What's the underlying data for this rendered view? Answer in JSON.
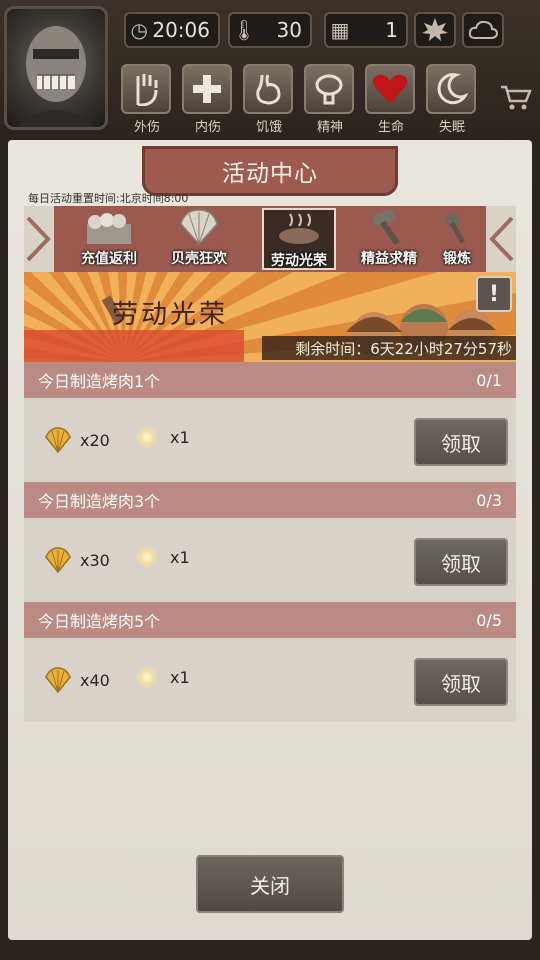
{
  "hud": {
    "time": "20:06",
    "temperature": "30",
    "day": "1",
    "status_icons": [
      {
        "icon": "palm-icon",
        "label": "外伤"
      },
      {
        "icon": "plus-icon",
        "label": "内伤"
      },
      {
        "icon": "stomach-icon",
        "label": "饥饿"
      },
      {
        "icon": "brain-icon",
        "label": "精神"
      },
      {
        "icon": "heart-icon",
        "label": "生命"
      },
      {
        "icon": "moon-icon",
        "label": "失眠"
      }
    ]
  },
  "panel": {
    "title": "活动中心",
    "reset_note": "每日活动重置时间:北京时间8:00",
    "tabs": [
      {
        "label": "充值返利",
        "icon": "chest-icon",
        "active": false
      },
      {
        "label": "贝壳狂欢",
        "icon": "shell-icon",
        "active": false
      },
      {
        "label": "劳动光荣",
        "icon": "meat-icon",
        "active": true
      },
      {
        "label": "精益求精",
        "icon": "hammer-icon",
        "active": false
      },
      {
        "label": "锻炼",
        "icon": "tool-icon",
        "active": false
      }
    ],
    "event": {
      "title": "劳动光荣",
      "remaining": "剩余时间：6天22小时27分57秒",
      "info_button": "!"
    },
    "tasks": [
      {
        "title": "今日制造烤肉1个",
        "progress": "0/1",
        "shell_amount": "x20",
        "orb_amount": "x1",
        "claim_label": "领取"
      },
      {
        "title": "今日制造烤肉3个",
        "progress": "0/3",
        "shell_amount": "x30",
        "orb_amount": "x1",
        "claim_label": "领取"
      },
      {
        "title": "今日制造烤肉5个",
        "progress": "0/5",
        "shell_amount": "x40",
        "orb_amount": "x1",
        "claim_label": "领取"
      }
    ],
    "close_label": "关闭"
  },
  "colors": {
    "accent_red": "#9d5b50",
    "task_header": "#bb8a82",
    "button_gray": "#5f5a55",
    "banner_orange": "#e08a3c"
  }
}
